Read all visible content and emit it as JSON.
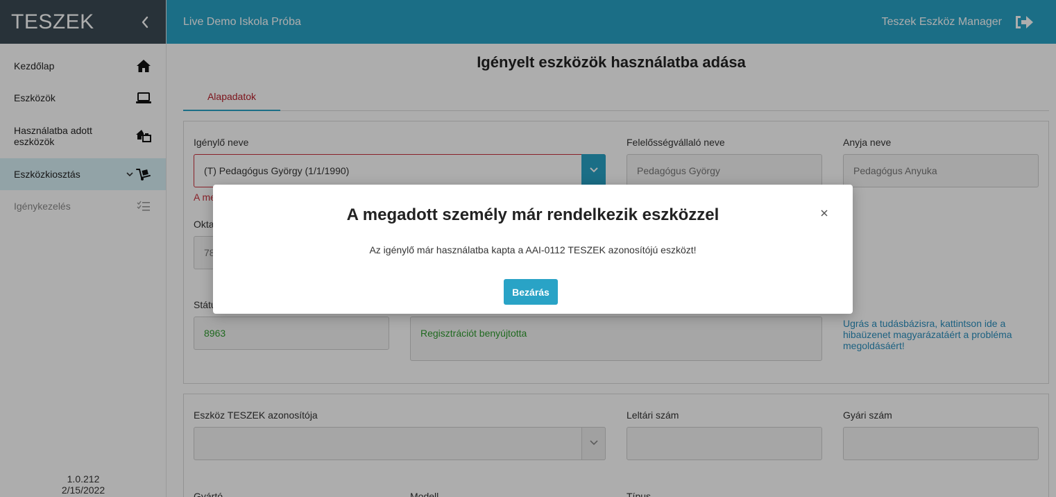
{
  "app": {
    "brand": "TESZEK",
    "version": "1.0.212",
    "build_date": "2/15/2022"
  },
  "topbar": {
    "school": "Live Demo Iskola Próba",
    "app_name": "Teszek Eszköz Manager"
  },
  "sidebar": {
    "items": [
      {
        "label": "Kezdőlap",
        "icon": "home-icon"
      },
      {
        "label": "Eszközök",
        "icon": "laptop-icon"
      },
      {
        "label": "Használatba adott eszközök",
        "icon": "house-handover-icon"
      },
      {
        "label": "Eszközkiosztás",
        "icon": "hand-truck-icon",
        "active": true
      },
      {
        "label": "Igénykezelés",
        "icon": "checklist-icon",
        "disabled": true
      }
    ]
  },
  "page": {
    "title": "Igényelt eszközök használatba adása",
    "tabs": [
      {
        "label": "Alapadatok",
        "active": true
      }
    ]
  },
  "form": {
    "requester_label": "Igénylő neve",
    "requester_value": "(T) Pedagógus György (1/1/1990)",
    "requester_error": "A me",
    "responsible_label": "Felelősségvállaló neve",
    "responsible_value": "Pedagógus György",
    "mother_label": "Anyja neve",
    "mother_value": "Pedagógus Anyuka",
    "edu_id_label": "Okta",
    "edu_id_value": "78",
    "status_label": "Státu",
    "status_code": "8963",
    "status_text": "Regisztrációt benyújtotta",
    "help_link": "Ugrás a tudásbázisra, kattintson ide a hibaüzenet magyarázatáért a probléma megoldásáért!",
    "device_id_label": "Eszköz TESZEK azonosítója",
    "device_id_value": "",
    "inventory_label": "Leltári szám",
    "inventory_value": "",
    "serial_label": "Gyári szám",
    "serial_value": "",
    "manufacturer_label": "Gyártó",
    "model_label": "Modell",
    "type_label": "Típus"
  },
  "modal": {
    "title": "A megadott személy már rendelkezik eszközzel",
    "message": "Az igénylő már használatba kapta a AAI-0112 TESZEK azonosítójú eszközt!",
    "close_button": "Bezárás"
  },
  "colors": {
    "accent": "#29a3c6",
    "brand_bg": "#3b4b55",
    "error": "#c9303b",
    "success": "#2e9b2e",
    "tab_active_text": "#b8202b"
  }
}
